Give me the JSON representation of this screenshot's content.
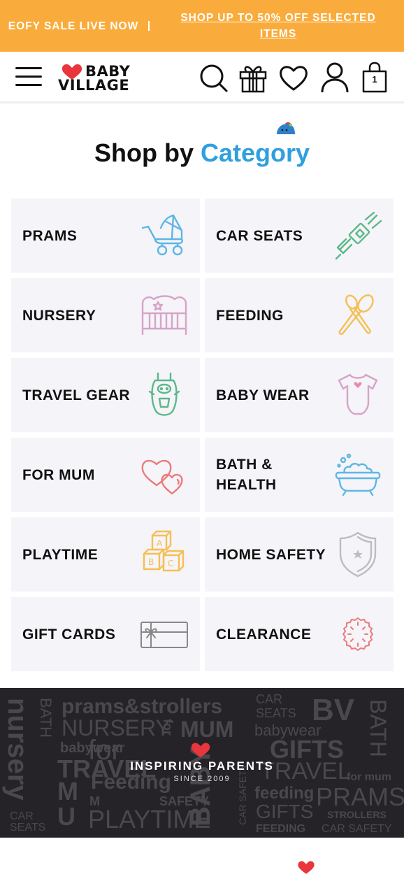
{
  "promo": {
    "left_text": "EOFY SALE LIVE NOW",
    "right_text": "SHOP UP TO 50% OFF SELECTED ITEMS"
  },
  "header": {
    "logo_line1": "BABY",
    "logo_line2": "VILLAGE",
    "cart_count": "1",
    "icons": [
      "menu-icon",
      "search-icon",
      "gift-icon",
      "heart-icon",
      "user-icon",
      "bag-icon"
    ]
  },
  "section": {
    "title_prefix": "Shop by",
    "title_accent": "Category"
  },
  "categories": [
    {
      "label": "PRAMS",
      "icon": "pram-icon"
    },
    {
      "label": "CAR SEATS",
      "icon": "seatbelt-icon"
    },
    {
      "label": "NURSERY",
      "icon": "cot-icon"
    },
    {
      "label": "FEEDING",
      "icon": "spoon-icon"
    },
    {
      "label": "TRAVEL GEAR",
      "icon": "baby-carrier-icon"
    },
    {
      "label": "BABY WEAR",
      "icon": "onesie-icon"
    },
    {
      "label": "FOR MUM",
      "icon": "hearts-icon"
    },
    {
      "label": "BATH & HEALTH",
      "icon": "bathtub-icon"
    },
    {
      "label": "PLAYTIME",
      "icon": "blocks-icon"
    },
    {
      "label": "HOME SAFETY",
      "icon": "shield-icon"
    },
    {
      "label": "GIFT CARDS",
      "icon": "gift-card-icon"
    },
    {
      "label": "CLEARANCE",
      "icon": "clearance-tag-icon"
    }
  ],
  "banner": {
    "title": "INSPIRING PARENTS",
    "subtitle": "SINCE 2009",
    "words": [
      "prams&strollers",
      "CAR",
      "SEATS",
      "BV",
      "BATH",
      "NURSERY",
      "for",
      "MUM",
      "babywear",
      "nursery",
      "BATH",
      "babywear",
      "for",
      "GIFTS",
      "Feeding",
      "TRAVEL",
      "M",
      "U",
      "M",
      "TRAVEL",
      "SAFETY",
      "BABY",
      "CAR SAFETY",
      "feeding",
      "PRAMS",
      "for mum",
      "CAR",
      "SEATS",
      "PLAYTIME",
      "GIFTS",
      "STROLLERS",
      "FEEDING",
      "CAR SAFETY"
    ]
  },
  "colors": {
    "promo_bg": "#f9ac3c",
    "accent_blue": "#2f9fde",
    "tile_bg": "#f5f4f8",
    "banner_bg": "#252327",
    "brand_red": "#e8363c"
  }
}
